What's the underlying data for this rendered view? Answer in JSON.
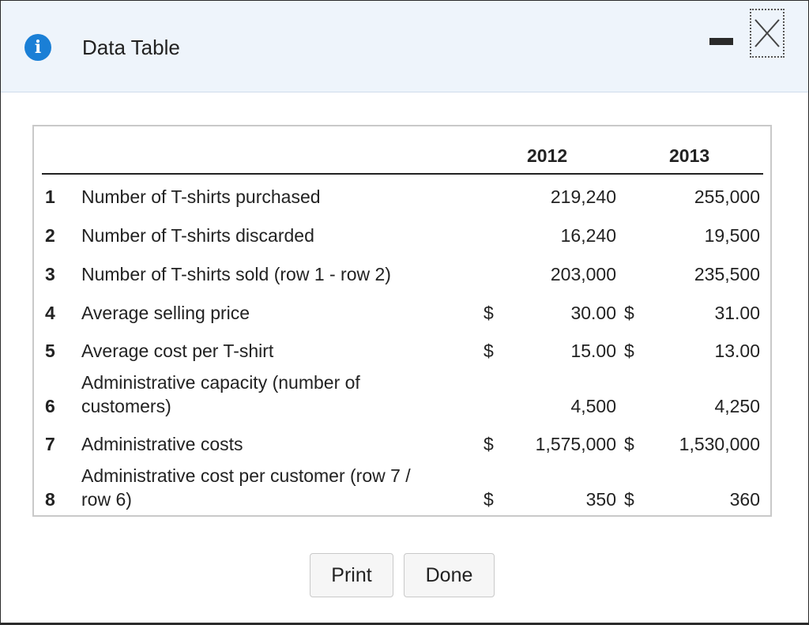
{
  "dialog": {
    "title": "Data Table",
    "icon": "info-icon"
  },
  "table": {
    "columns": [
      "2012",
      "2013"
    ],
    "rows": [
      {
        "num": "1",
        "label": [
          "Number of T-shirts purchased"
        ],
        "c2012": "219,240",
        "c2013": "255,000",
        "sym2012": "",
        "sym2013": ""
      },
      {
        "num": "2",
        "label": [
          "Number of T-shirts discarded"
        ],
        "c2012": "16,240",
        "c2013": "19,500",
        "sym2012": "",
        "sym2013": ""
      },
      {
        "num": "3",
        "label": [
          "Number of T-shirts sold (row 1 - row 2)"
        ],
        "c2012": "203,000",
        "c2013": "235,500",
        "sym2012": "",
        "sym2013": ""
      },
      {
        "num": "4",
        "label": [
          "Average selling price"
        ],
        "c2012": "30.00",
        "c2013": "31.00",
        "sym2012": "$",
        "sym2013": "$"
      },
      {
        "num": "5",
        "label": [
          "Average cost per T-shirt"
        ],
        "c2012": "15.00",
        "c2013": "13.00",
        "sym2012": "$",
        "sym2013": "$"
      },
      {
        "num": "6",
        "label": [
          "Administrative capacity (number of",
          "customers)"
        ],
        "c2012": "4,500",
        "c2013": "4,250",
        "sym2012": "",
        "sym2013": ""
      },
      {
        "num": "7",
        "label": [
          "Administrative costs"
        ],
        "c2012": "1,575,000",
        "c2013": "1,530,000",
        "sym2012": "$",
        "sym2013": "$"
      },
      {
        "num": "8",
        "label": [
          "Administrative cost per customer (row 7 /",
          "row 6)"
        ],
        "c2012": "350",
        "c2013": "360",
        "sym2012": "$",
        "sym2013": "$"
      }
    ]
  },
  "buttons": {
    "print": "Print",
    "done": "Done"
  }
}
